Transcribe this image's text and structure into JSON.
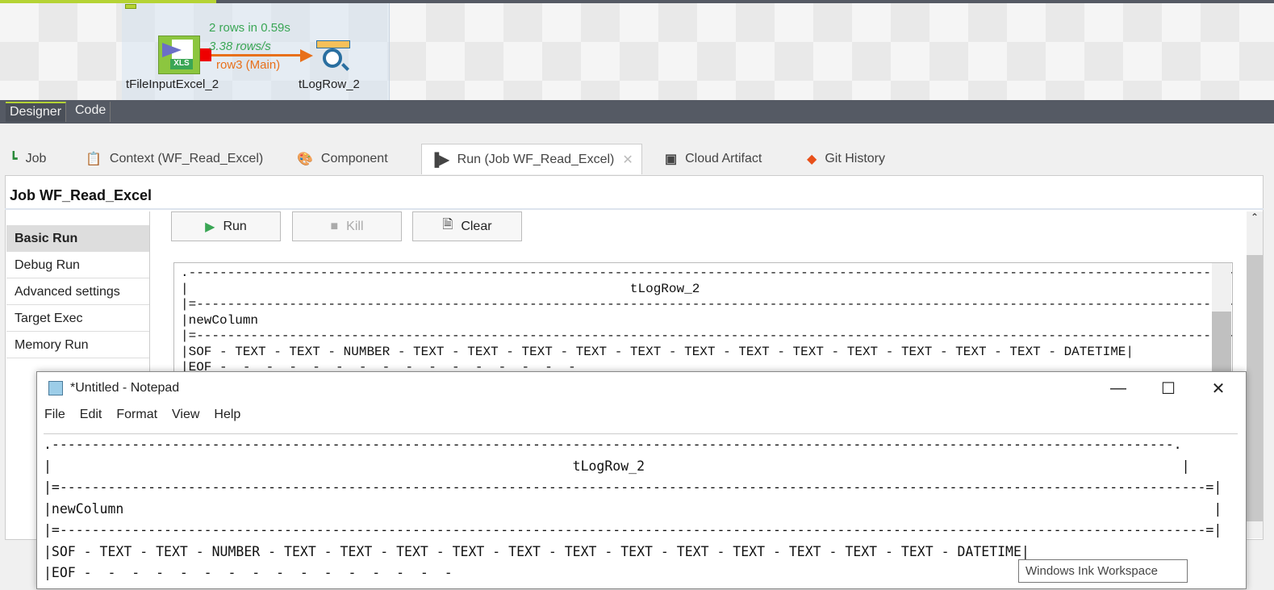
{
  "designer": {
    "stats_rows": "2 rows in 0.59s",
    "stats_rate": "3.38 rows/s",
    "link_label": "row3 (Main)",
    "component_input": "tFileInputExcel_2",
    "component_output": "tLogRow_2",
    "xls_badge": "XLS"
  },
  "editor_tabs": [
    "Designer",
    "Code"
  ],
  "view_tabs": [
    {
      "label": "Job"
    },
    {
      "label": "Context (WF_Read_Excel)"
    },
    {
      "label": "Component"
    },
    {
      "label": "Run (Job WF_Read_Excel)"
    },
    {
      "label": "Cloud Artifact"
    },
    {
      "label": "Git History"
    }
  ],
  "job_title": "Job WF_Read_Excel",
  "sidebar": [
    "Basic Run",
    "Debug Run",
    "Advanced settings",
    "Target Exec",
    "Memory Run"
  ],
  "buttons": {
    "run": "Run",
    "kill": "Kill",
    "clear": "Clear"
  },
  "console_text": ".--------------------------------------------------------------------------------------------------------------------------------------------.\n|                                                         tLogRow_2                                                                          |\n|=-------------------------------------------------------------------------------------------------------------------------------------------=|\n|newColumn\n|=-------------------------------------------------------------------------------------------------------------------------------------------=|\n|SOF - TEXT - TEXT - NUMBER - TEXT - TEXT - TEXT - TEXT - TEXT - TEXT - TEXT - TEXT - TEXT - TEXT - TEXT - TEXT - DATETIME|\n|EOF -  -  -  -  -  -  -  -  -  -  -  -  -  -  -  -",
  "notepad": {
    "title": "*Untitled - Notepad",
    "menu": [
      "File",
      "Edit",
      "Format",
      "View",
      "Help"
    ],
    "text": ".--------------------------------------------------------------------------------------------------------------------------------------------.\n|                                                                 tLogRow_2                                                                   |\n|=-----------------------------------------------------------------------------------------------------------------------------------------------=|\n|newColumn                                                                                                                                        |\n|=-----------------------------------------------------------------------------------------------------------------------------------------------=|\n|SOF - TEXT - TEXT - NUMBER - TEXT - TEXT - TEXT - TEXT - TEXT - TEXT - TEXT - TEXT - TEXT - TEXT - TEXT - TEXT - DATETIME|\n|EOF -  -  -  -  -  -  -  -  -  -  -  -  -  -  -  -"
  },
  "tooltip": "Windows Ink Workspace"
}
